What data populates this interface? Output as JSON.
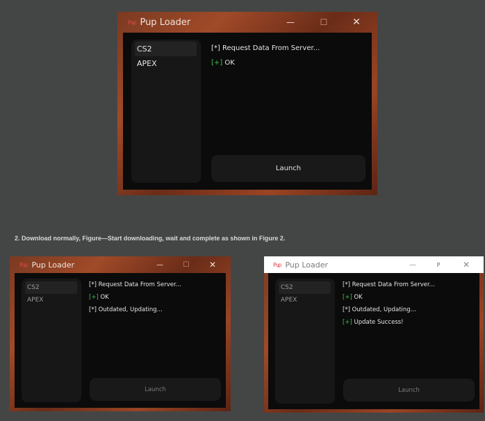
{
  "caption": "2. Download normally, Figure—Start downloading, wait and complete as shown in Figure 2.",
  "windows": [
    {
      "title": "Pup Loader",
      "logo": "Pup",
      "controls": {
        "minimize_icon": "—",
        "maximize_icon": "☐",
        "close_icon": "✕"
      },
      "sidebar": [
        {
          "label": "CS2",
          "selected": true
        },
        {
          "label": "APEX",
          "selected": false
        }
      ],
      "log": [
        {
          "tag": "[*]",
          "text": "Request Data From Server..."
        },
        {
          "tag": "[+]",
          "text": "OK"
        }
      ],
      "launch_label": "Launch"
    },
    {
      "title": "Pup Loader",
      "logo": "Pup",
      "controls": {
        "minimize_icon": "—",
        "maximize_icon": "☐",
        "close_icon": "✕"
      },
      "sidebar": [
        {
          "label": "CS2",
          "selected": true
        },
        {
          "label": "APEX",
          "selected": false
        }
      ],
      "log": [
        {
          "tag": "[*]",
          "text": "Request Data From Server..."
        },
        {
          "tag": "[+]",
          "text": "OK"
        },
        {
          "tag": "[*]",
          "text": "Outdated, Updating..."
        }
      ],
      "launch_label": "Launch"
    },
    {
      "title": "Pup Loader",
      "logo": "Pup",
      "controls": {
        "minimize_icon": "—",
        "maximize_icon": "P",
        "close_icon": "✕"
      },
      "sidebar": [
        {
          "label": "CS2",
          "selected": true
        },
        {
          "label": "APEX",
          "selected": false
        }
      ],
      "log": [
        {
          "tag": "[*]",
          "text": "Request Data From Server..."
        },
        {
          "tag": "[+]",
          "text": "OK"
        },
        {
          "tag": "[*]",
          "text": "Outdated, Updating..."
        },
        {
          "tag": "[+]",
          "text": "Update Success!"
        }
      ],
      "launch_label": "Launch"
    }
  ],
  "colors": {
    "background": "#444645",
    "frame": "#8a3c20",
    "panel": "#0b0b0b",
    "sidebar": "#171717",
    "ok_tag": "#3ec04a",
    "logo": "#e04848"
  }
}
